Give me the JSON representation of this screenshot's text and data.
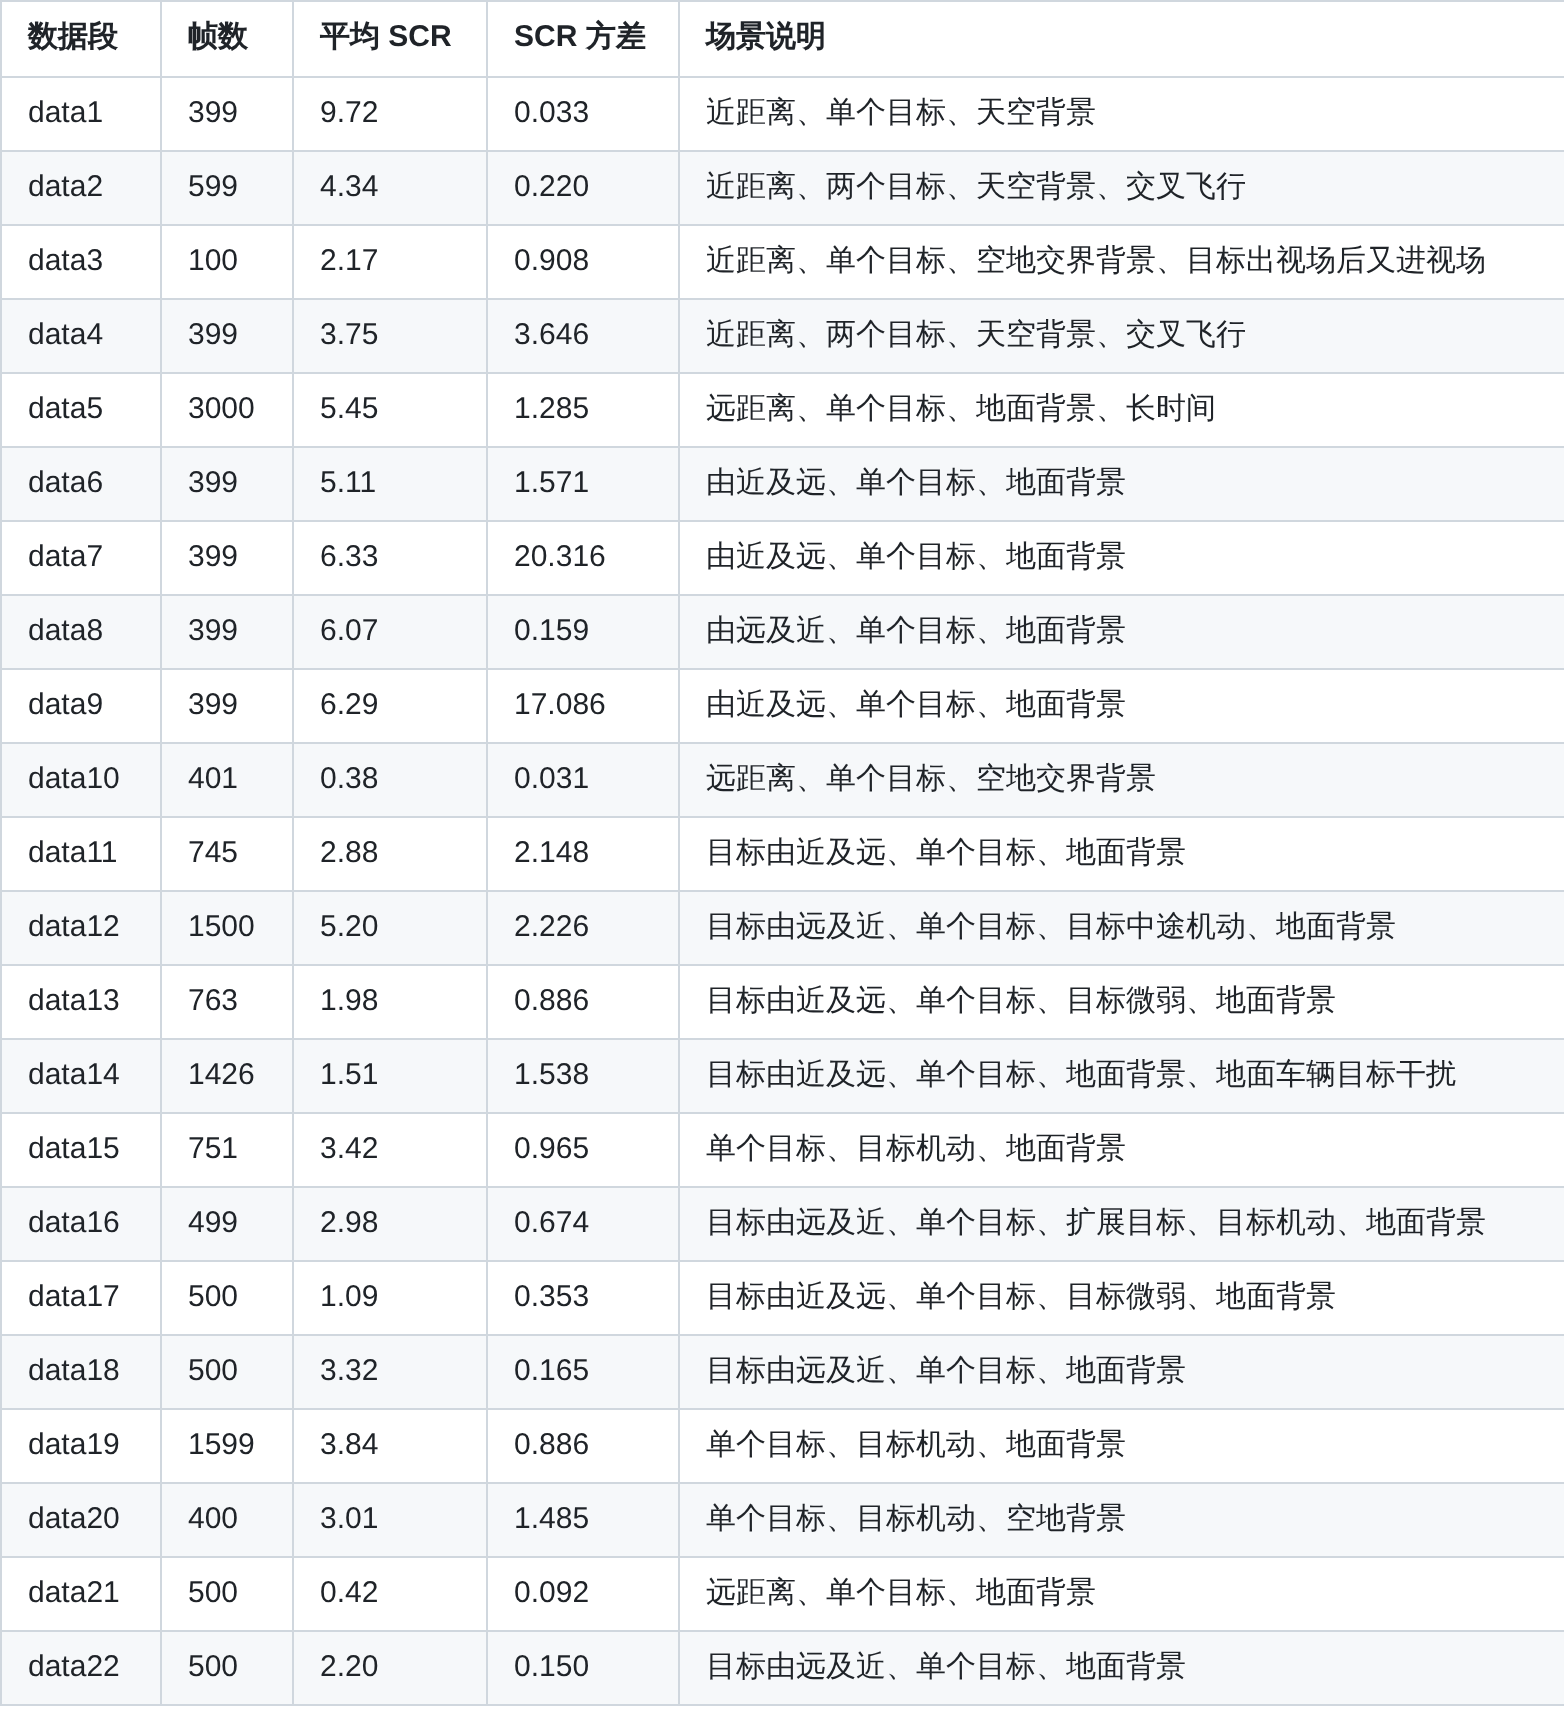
{
  "table": {
    "columns": [
      "数据段",
      "帧数",
      "平均 SCR",
      "SCR 方差",
      "场景说明"
    ],
    "rows": [
      [
        "data1",
        "399",
        "9.72",
        "0.033",
        "近距离、单个目标、天空背景"
      ],
      [
        "data2",
        "599",
        "4.34",
        "0.220",
        "近距离、两个目标、天空背景、交叉飞行"
      ],
      [
        "data3",
        "100",
        "2.17",
        "0.908",
        "近距离、单个目标、空地交界背景、目标出视场后又进视场"
      ],
      [
        "data4",
        "399",
        "3.75",
        "3.646",
        "近距离、两个目标、天空背景、交叉飞行"
      ],
      [
        "data5",
        "3000",
        "5.45",
        "1.285",
        "远距离、单个目标、地面背景、长时间"
      ],
      [
        "data6",
        "399",
        "5.11",
        "1.571",
        "由近及远、单个目标、地面背景"
      ],
      [
        "data7",
        "399",
        "6.33",
        "20.316",
        "由近及远、单个目标、地面背景"
      ],
      [
        "data8",
        "399",
        "6.07",
        "0.159",
        "由远及近、单个目标、地面背景"
      ],
      [
        "data9",
        "399",
        "6.29",
        "17.086",
        "由近及远、单个目标、地面背景"
      ],
      [
        "data10",
        "401",
        "0.38",
        "0.031",
        "远距离、单个目标、空地交界背景"
      ],
      [
        "data11",
        "745",
        "2.88",
        "2.148",
        "目标由近及远、单个目标、地面背景"
      ],
      [
        "data12",
        "1500",
        "5.20",
        "2.226",
        "目标由远及近、单个目标、目标中途机动、地面背景"
      ],
      [
        "data13",
        "763",
        "1.98",
        "0.886",
        "目标由近及远、单个目标、目标微弱、地面背景"
      ],
      [
        "data14",
        "1426",
        "1.51",
        "1.538",
        "目标由近及远、单个目标、地面背景、地面车辆目标干扰"
      ],
      [
        "data15",
        "751",
        "3.42",
        "0.965",
        "单个目标、目标机动、地面背景"
      ],
      [
        "data16",
        "499",
        "2.98",
        "0.674",
        "目标由远及近、单个目标、扩展目标、目标机动、地面背景"
      ],
      [
        "data17",
        "500",
        "1.09",
        "0.353",
        "目标由近及远、单个目标、目标微弱、地面背景"
      ],
      [
        "data18",
        "500",
        "3.32",
        "0.165",
        "目标由远及近、单个目标、地面背景"
      ],
      [
        "data19",
        "1599",
        "3.84",
        "0.886",
        "单个目标、目标机动、地面背景"
      ],
      [
        "data20",
        "400",
        "3.01",
        "1.485",
        "单个目标、目标机动、空地背景"
      ],
      [
        "data21",
        "500",
        "0.42",
        "0.092",
        "远距离、单个目标、地面背景"
      ],
      [
        "data22",
        "500",
        "2.20",
        "0.150",
        "目标由远及近、单个目标、地面背景"
      ]
    ]
  }
}
